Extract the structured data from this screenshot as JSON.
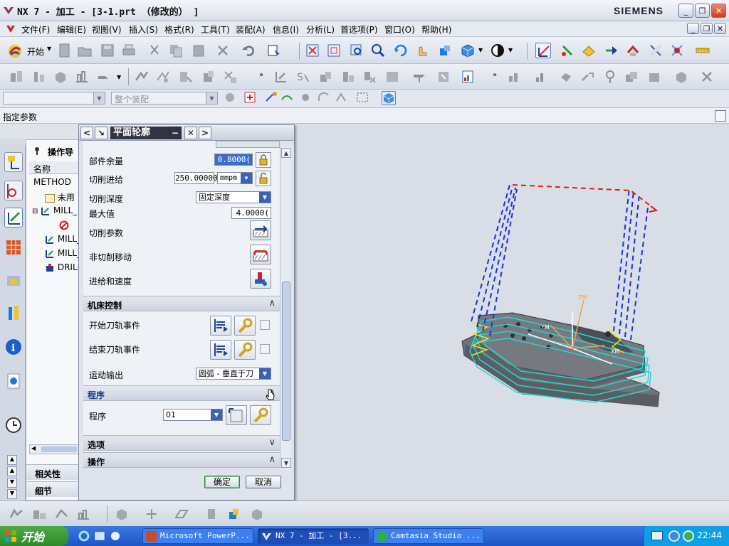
{
  "window": {
    "title": "NX 7 - 加工 - [3-1.prt （修改的） ]",
    "brand": "SIEMENS"
  },
  "menubar": {
    "items": [
      "文件(F)",
      "编辑(E)",
      "视图(V)",
      "插入(S)",
      "格式(R)",
      "工具(T)",
      "装配(A)",
      "信息(I)",
      "分析(L)",
      "首选项(P)",
      "窗口(O)",
      "帮助(H)"
    ]
  },
  "toolbar": {
    "start_label": "开始"
  },
  "selection_bar": {
    "filter_placeholder": "",
    "assembly_scope": "整个装配"
  },
  "cue_line": {
    "text": "指定参数"
  },
  "navigator": {
    "title": "操作导",
    "column_name": "名称",
    "rows": [
      {
        "label": "METHOD",
        "icon": "none"
      },
      {
        "label": "未用",
        "icon": "unused-folder-icon"
      },
      {
        "label": "MILL_",
        "icon": "mill-op-icon"
      },
      {
        "label": "",
        "icon": "prohibited-icon"
      },
      {
        "label": "MILL_",
        "icon": "mill-op-icon"
      },
      {
        "label": "MILL_",
        "icon": "mill-op-icon"
      },
      {
        "label": "DRILL",
        "icon": "drill-op-icon"
      }
    ],
    "bottom_tabs": [
      "相关性",
      "细节"
    ]
  },
  "dialog": {
    "title": "平面轮廓",
    "fields": {
      "part_stock_label": "部件余量",
      "part_stock_value": "0.8000(",
      "cut_feed_label": "切削进给",
      "cut_feed_value": "250.00000",
      "cut_feed_unit": "mmpm",
      "cut_depth_label": "切削深度",
      "cut_depth_value": "固定深度",
      "max_value_label": "最大值",
      "max_value_value": "4.0000(",
      "cut_params_label": "切削参数",
      "non_cut_moves_label": "非切削移动",
      "feeds_speeds_label": "进给和速度"
    },
    "machine_control": {
      "title": "机床控制",
      "start_event_label": "开始刀轨事件",
      "end_event_label": "结束刀轨事件",
      "motion_output_label": "运动输出",
      "motion_output_value": "圆弧 - 垂直于刀"
    },
    "program": {
      "title": "程序",
      "program_label": "程序",
      "program_value": "01"
    },
    "options_title": "选项",
    "actions_title": "操作",
    "ok_label": "确定",
    "cancel_label": "取消"
  },
  "graphics": {
    "wcs_label": "ZM",
    "axis_labels": [
      "YM",
      "XM"
    ]
  },
  "taskbar": {
    "start_label": "开始",
    "tasks": [
      {
        "label": "Microsoft PowerP...",
        "active": false
      },
      {
        "label": "NX 7 - 加工 - [3...",
        "active": true
      },
      {
        "label": "Camtasia Studio ...",
        "active": false
      }
    ],
    "clock": "22:44"
  },
  "colors": {
    "accent": "#1d55c6",
    "toolpath": "#22d6d6",
    "tool_axis": "#1b2fd6",
    "retract": "#e21b1b"
  }
}
